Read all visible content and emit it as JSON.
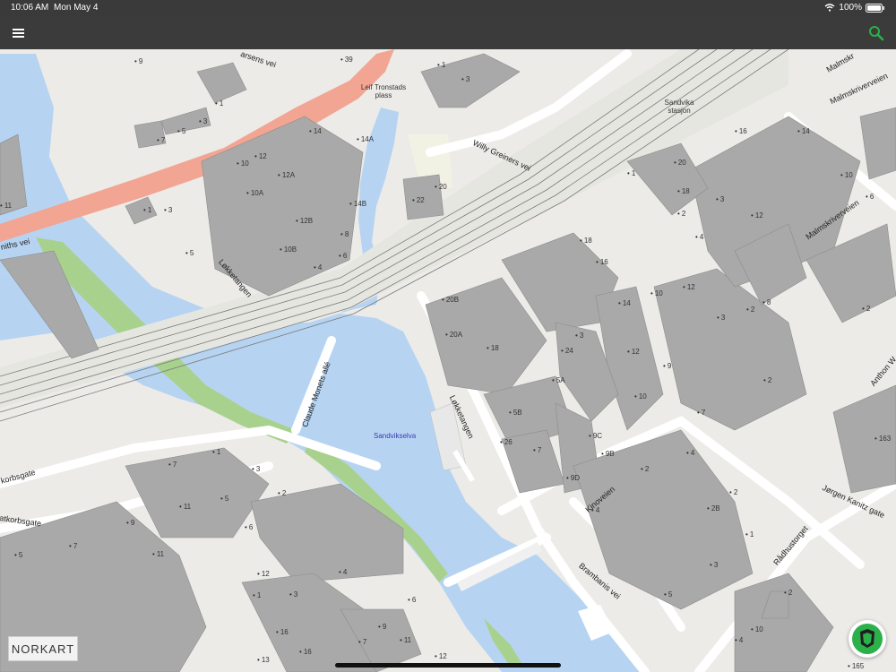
{
  "status_bar": {
    "time": "10:06 AM",
    "date": "Mon May 4",
    "battery": "100%"
  },
  "toolbar": {
    "menu_icon": "hamburger-menu-icon",
    "search_icon": "search-icon"
  },
  "map": {
    "place_names": [
      {
        "id": "leif-tronstads",
        "text": "Leif Tronstads\nplass"
      },
      {
        "id": "sandvika-stasjon",
        "text": "Sandvika\nstasjon"
      }
    ],
    "water_names": [
      "Sandvikselva"
    ],
    "streets": [
      "Willy Greiners vei",
      "Løkketangen",
      "Løkketangen",
      "Claude Monets allé",
      "Kinoveien",
      "Brambanis vei",
      "Rådhustorget",
      "Jørgen Kanitz gate",
      "Malmskriverveien",
      "Malmskriverveien",
      "Anthon W",
      "korbsgate",
      "atkorbsgate",
      "arsens vei",
      "niths vei",
      "Malmskr"
    ],
    "house_numbers": [
      "9",
      "39",
      "1",
      "3",
      "1",
      "5",
      "3",
      "7",
      "14",
      "14A",
      "12",
      "10",
      "12A",
      "10A",
      "14B",
      "12B",
      "8",
      "10B",
      "6",
      "4",
      "5",
      "3",
      "1",
      "11",
      "20",
      "22",
      "1",
      "20",
      "18",
      "3",
      "2",
      "4",
      "16",
      "14",
      "12",
      "10",
      "6",
      "18",
      "16",
      "14",
      "12",
      "10",
      "8",
      "2",
      "3",
      "2",
      "9",
      "7",
      "2",
      "163",
      "20B",
      "20A",
      "18",
      "3",
      "24",
      "12",
      "5A",
      "5B",
      "10",
      "26",
      "7",
      "9C",
      "9B",
      "9D",
      "7",
      "1",
      "3",
      "5",
      "2",
      "9",
      "11",
      "7",
      "2",
      "4",
      "6",
      "4",
      "4",
      "2",
      "2B",
      "1",
      "3",
      "5",
      "12",
      "1",
      "5",
      "3",
      "16",
      "16",
      "7",
      "9",
      "11",
      "13",
      "6",
      "12",
      "2",
      "165",
      "10",
      "4",
      "11"
    ],
    "logo": "NORKART",
    "locate_icon": "location-shield-icon"
  },
  "colors": {
    "toolbar": "#3b3b3b",
    "water": "#b6d4f2",
    "building": "#a9a9a9",
    "park": "#a9d18e",
    "road_main": "#f2a593",
    "accent": "#2bb04a"
  }
}
